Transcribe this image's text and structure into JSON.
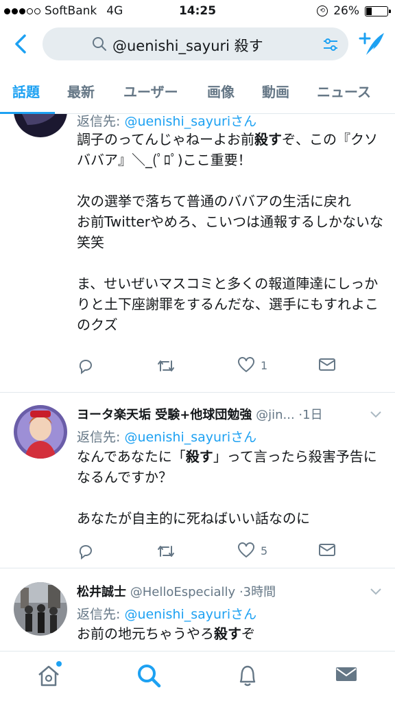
{
  "status_bar": {
    "carrier": "SoftBank",
    "network": "4G",
    "time": "14:25",
    "battery": "26%",
    "signal_bars": 3
  },
  "search": {
    "query": "@uenishi_sayuri 殺す"
  },
  "tabs": [
    {
      "label": "話題",
      "active": true
    },
    {
      "label": "最新"
    },
    {
      "label": "ユーザー"
    },
    {
      "label": "画像"
    },
    {
      "label": "動画"
    },
    {
      "label": "ニュース"
    }
  ],
  "tweets": [
    {
      "reply_prefix": "返信先: ",
      "reply_to": "@uenishi_sayuriさん",
      "body_parts": [
        {
          "text": "調子のってんじゃねーよお前"
        },
        {
          "text": "殺す",
          "bold": true
        },
        {
          "text": "ぞ、この『クソババア』＼_(ﾟﾛﾟ)ここ重要！\n\n次の選挙で落ちて普通のババアの生活に戻れ\nお前Twitterやめろ、こいつは通報するしかないな笑笑\n\nま、せいぜいマスコミと多くの報道陣達にしっかりと土下座謝罪をするんだな、選手にもすれよこのクズ"
        }
      ],
      "likes": "1"
    },
    {
      "name": "ヨータ楽天垢 受験+他球団勉強",
      "handle": "@jin...",
      "time": "1日",
      "reply_prefix": "返信先: ",
      "reply_to": "@uenishi_sayuriさん",
      "body_parts": [
        {
          "text": "なんであなたに「"
        },
        {
          "text": "殺す",
          "bold": true
        },
        {
          "text": "」って言ったら殺害予告になるんですか？\n\nあなたが自主的に死ねばいい話なのに"
        }
      ],
      "likes": "5"
    },
    {
      "name": "松井誠士",
      "handle": "@HelloEspecially",
      "time": "3時間",
      "reply_prefix": "返信先: ",
      "reply_to": "@uenishi_sayuriさん",
      "body_parts": [
        {
          "text": "お前の地元ちゃうやろ"
        },
        {
          "text": "殺す",
          "bold": true
        },
        {
          "text": "ぞ"
        }
      ]
    }
  ],
  "colors": {
    "accent": "#1da1f2",
    "secondary_text": "#657786",
    "divider": "#e1e8ed"
  }
}
